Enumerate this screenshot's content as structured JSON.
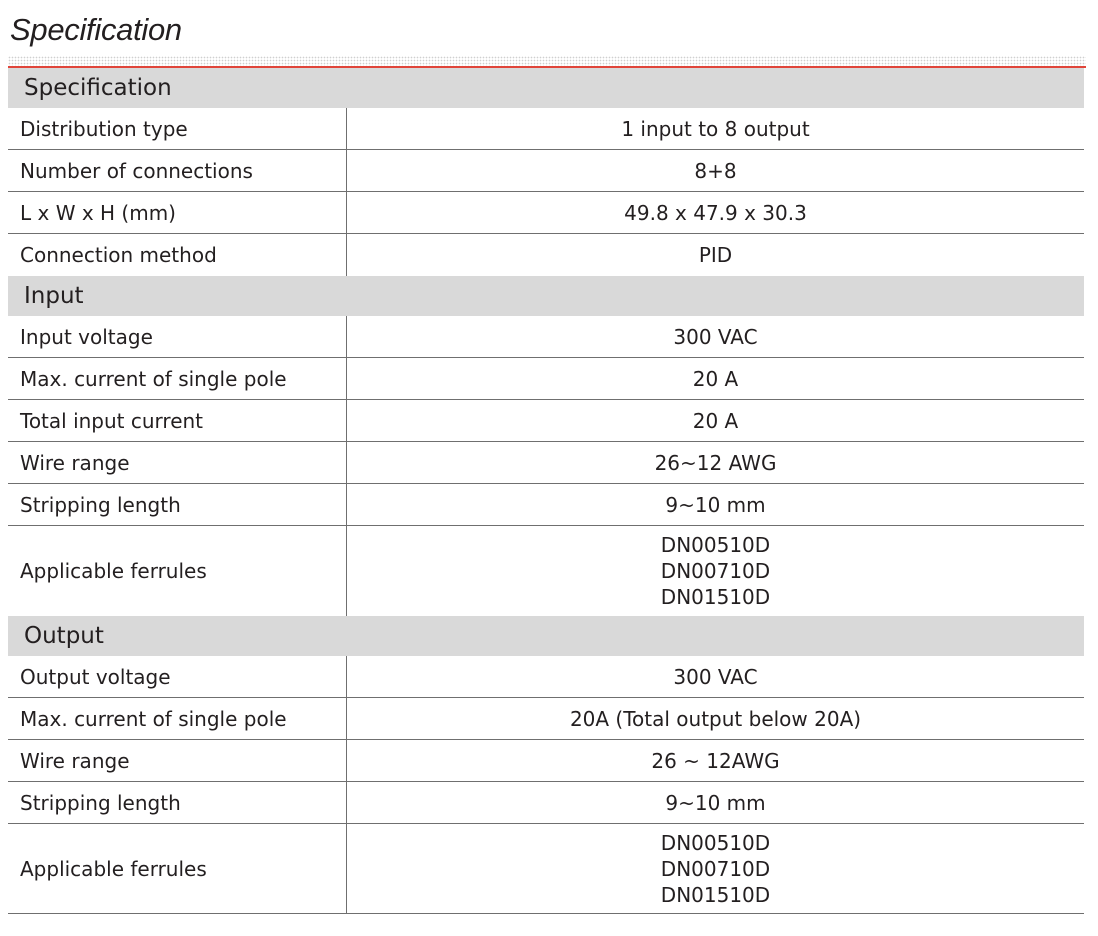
{
  "page_title": "Specification",
  "sections": [
    {
      "header": "Specification",
      "rows": [
        {
          "label": "Distribution type",
          "values": [
            "1 input to 8 output"
          ]
        },
        {
          "label": "Number of connections",
          "values": [
            "8+8"
          ]
        },
        {
          "label": "L x W x H (mm)",
          "values": [
            "49.8 x 47.9 x 30.3"
          ]
        },
        {
          "label": "Connection method",
          "values": [
            "PID"
          ]
        }
      ]
    },
    {
      "header": "Input",
      "rows": [
        {
          "label": "Input voltage",
          "values": [
            "300 VAC"
          ]
        },
        {
          "label": "Max. current of single pole",
          "values": [
            "20 A"
          ]
        },
        {
          "label": "Total input current",
          "values": [
            "20 A"
          ]
        },
        {
          "label": "Wire range",
          "values": [
            "26~12 AWG"
          ]
        },
        {
          "label": "Stripping length",
          "values": [
            "9~10 mm"
          ]
        },
        {
          "label": "Applicable ferrules",
          "values": [
            "DN00510D",
            "DN00710D",
            "DN01510D"
          ]
        }
      ]
    },
    {
      "header": "Output",
      "rows": [
        {
          "label": "Output voltage",
          "values": [
            "300 VAC"
          ]
        },
        {
          "label": "Max. current of single pole",
          "values": [
            "20A (Total output below 20A)"
          ]
        },
        {
          "label": "Wire range",
          "values": [
            "26 ~ 12AWG"
          ]
        },
        {
          "label": "Stripping length",
          "values": [
            "9~10 mm"
          ]
        },
        {
          "label": "Applicable ferrules",
          "values": [
            "DN00510D",
            "DN00710D",
            "DN01510D"
          ]
        }
      ]
    }
  ],
  "colors": {
    "accent_rule": "#e0453a",
    "section_header_bg": "#d9d9d9",
    "text": "#231f20",
    "grid_line": "#6f6f6f"
  }
}
